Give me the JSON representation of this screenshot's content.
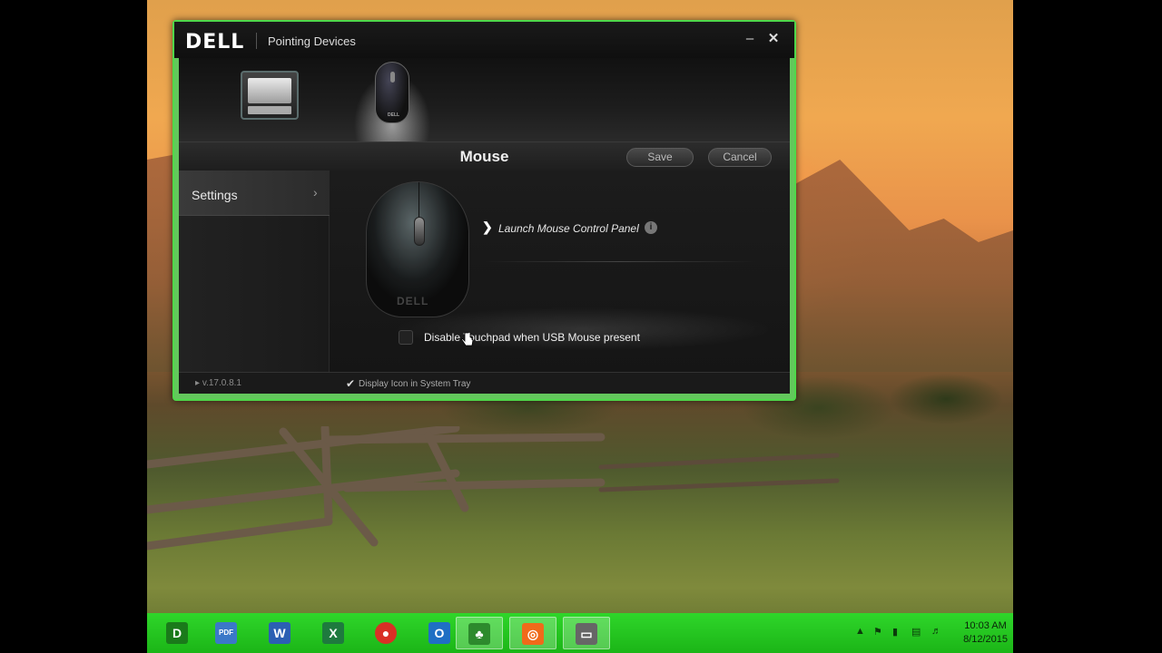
{
  "window": {
    "brand": "DELL",
    "title": "Pointing Devices",
    "minimize_glyph": "–",
    "close_glyph": "✕"
  },
  "devices": [
    {
      "name": "touchpad",
      "icon": "touchpad-icon"
    },
    {
      "name": "mouse",
      "icon": "mouse-icon",
      "selected": true,
      "caption": "DELL"
    }
  ],
  "header": {
    "title": "Mouse",
    "save_label": "Save",
    "cancel_label": "Cancel"
  },
  "sidebar": {
    "items": [
      {
        "label": "Settings"
      }
    ]
  },
  "content": {
    "mouse_brand": "DELL",
    "launch_label": "Launch Mouse Control Panel",
    "info_glyph": "i",
    "disable_touchpad_label": "Disable Touchpad when USB Mouse present",
    "disable_touchpad_checked": false
  },
  "footer": {
    "version": "v.17.0.8.1",
    "tray_label": "Display Icon in System Tray",
    "tray_checked": true
  },
  "taskbar": {
    "apps": [
      {
        "name": "app-d",
        "glyph": "D",
        "color": "#1a7a1a"
      },
      {
        "name": "pdf",
        "glyph": "PDF",
        "color": "#3b78c8"
      },
      {
        "name": "word",
        "glyph": "W",
        "color": "#2b5fb3"
      },
      {
        "name": "excel",
        "glyph": "X",
        "color": "#1e7a3e"
      },
      {
        "name": "chrome",
        "glyph": "●",
        "color": "#d93025"
      },
      {
        "name": "outlook",
        "glyph": "O",
        "color": "#1f6fc4"
      },
      {
        "name": "game",
        "glyph": "♣",
        "color": "#2d8a2d"
      },
      {
        "name": "app-orange",
        "glyph": "◎",
        "color": "#f06a1a"
      },
      {
        "name": "touchpad-app",
        "glyph": "▭",
        "color": "#666666"
      }
    ],
    "clock_time": "10:03 AM",
    "clock_date": "8/12/2015"
  }
}
